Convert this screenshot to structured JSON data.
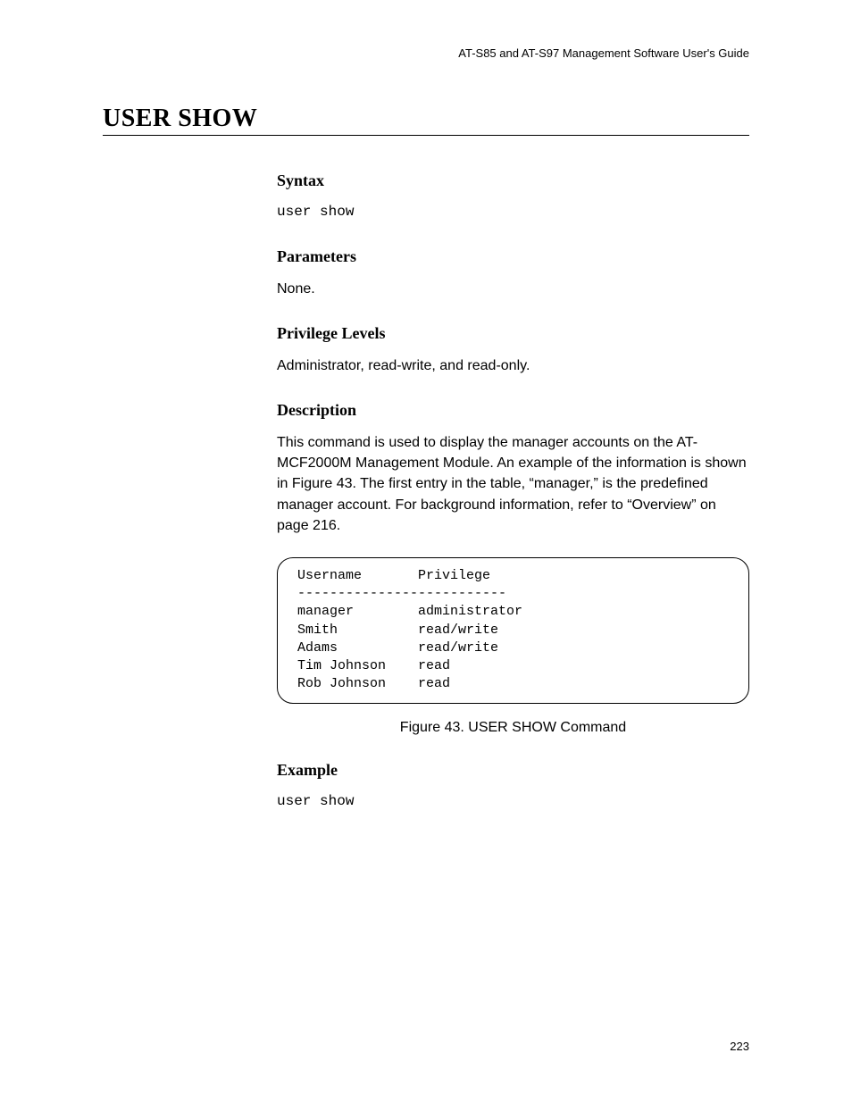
{
  "header": {
    "running": "AT-S85 and AT-S97 Management Software User's Guide"
  },
  "title": "USER SHOW",
  "sections": {
    "syntax": {
      "heading": "Syntax",
      "code": "user show"
    },
    "parameters": {
      "heading": "Parameters",
      "text": "None."
    },
    "privilege": {
      "heading": "Privilege Levels",
      "text": "Administrator, read-write, and read-only."
    },
    "description": {
      "heading": "Description",
      "text": "This command is used to display the manager accounts on the AT-MCF2000M Management Module. An example of the information is shown in Figure 43. The first entry in the table, “manager,” is the predefined manager account. For background information, refer to “Overview” on page 216."
    },
    "output": {
      "header_username": "Username",
      "header_privilege": "Privilege",
      "divider": "--------------------------",
      "rows": [
        {
          "user": "manager",
          "priv": "administrator"
        },
        {
          "user": "Smith",
          "priv": "read/write"
        },
        {
          "user": "Adams",
          "priv": "read/write"
        },
        {
          "user": "Tim Johnson",
          "priv": "read"
        },
        {
          "user": "Rob Johnson",
          "priv": "read"
        }
      ],
      "caption": "Figure 43. USER SHOW Command"
    },
    "example": {
      "heading": "Example",
      "code": "user show"
    }
  },
  "page_number": "223"
}
